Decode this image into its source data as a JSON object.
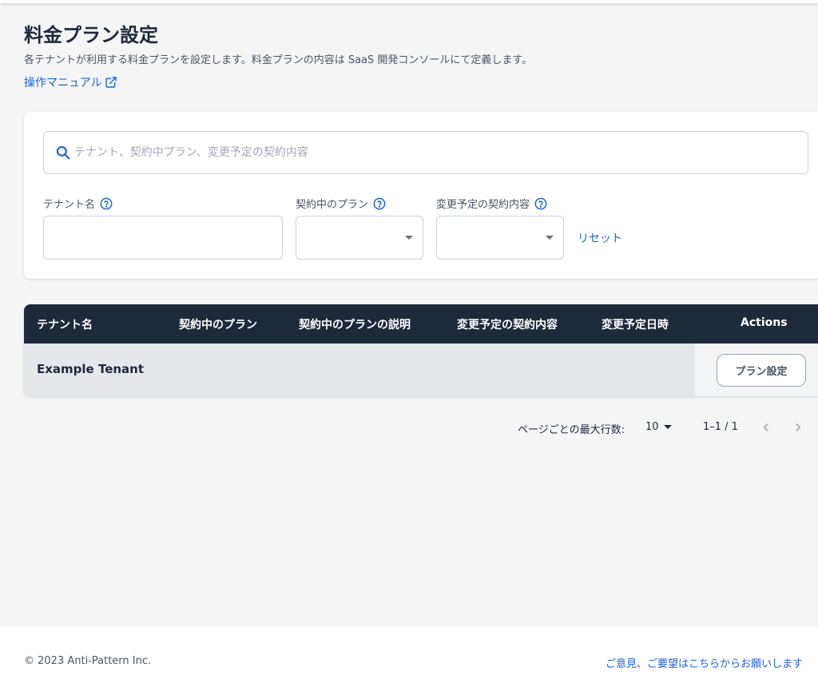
{
  "header": {
    "title": "料金プラン設定",
    "description": "各テナントが利用する料金プランを設定します。料金プランの内容は SaaS 開発コンソールにて定義します。",
    "manual_link": "操作マニュアル"
  },
  "filters": {
    "search_placeholder": "テナント、契約中プラン、変更予定の契約内容",
    "tenant_name_label": "テナント名",
    "current_plan_label": "契約中のプラン",
    "planned_change_label": "変更予定の契約内容",
    "reset_label": "リセット"
  },
  "table": {
    "columns": [
      "テナント名",
      "契約中のプラン",
      "契約中のプランの説明",
      "変更予定の契約内容",
      "変更予定日時",
      "Actions"
    ],
    "rows": [
      {
        "tenant_name": "Example Tenant",
        "current_plan": "",
        "plan_description": "",
        "planned_change": "",
        "planned_date": "",
        "action_label": "プラン設定"
      }
    ]
  },
  "pagination": {
    "rows_per_page_label": "ページごとの最大行数:",
    "rows_per_page": "10",
    "range": "1–1 / 1"
  },
  "footer": {
    "copyright": "© 2023 Anti-Pattern Inc.",
    "feedback_link": "ご意見、ご要望はこちらからお願いします"
  },
  "colors": {
    "accent": "#1d63d6",
    "table_header": "#1e293b",
    "background": "#f5f5f6"
  }
}
